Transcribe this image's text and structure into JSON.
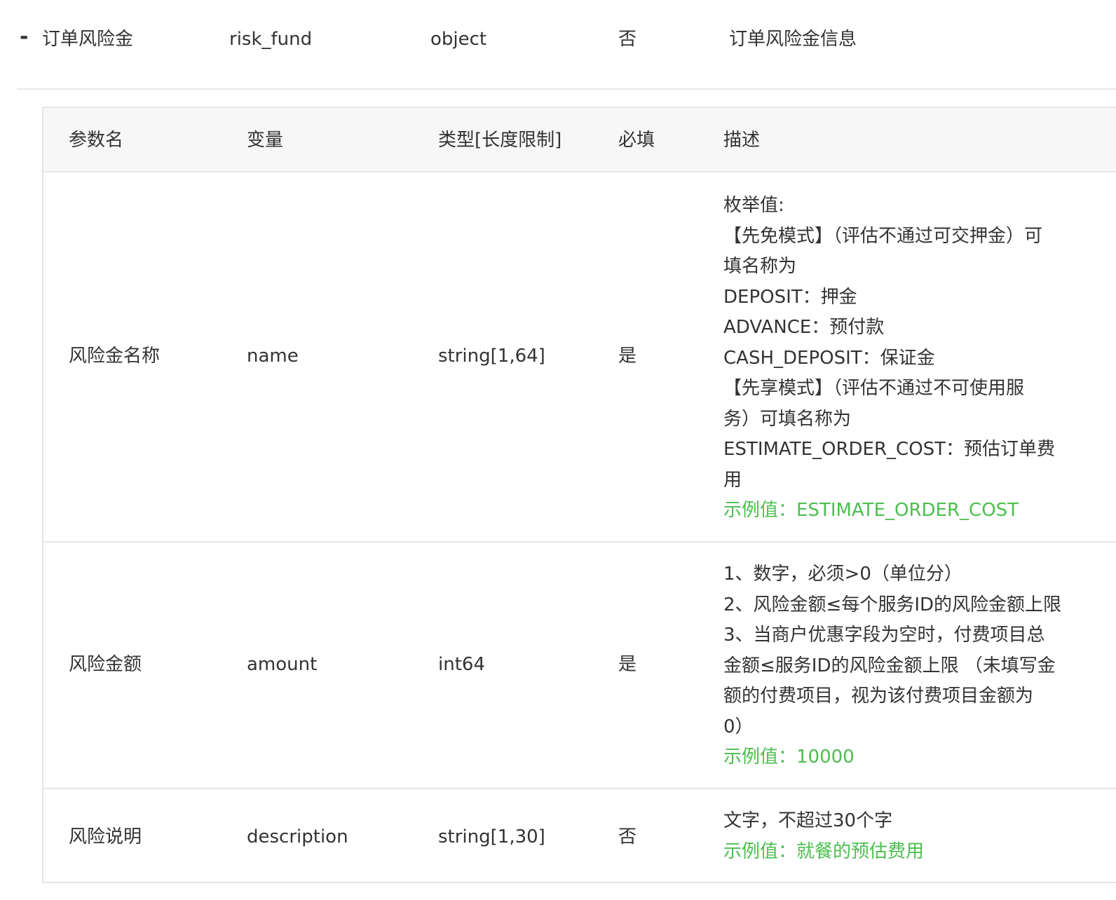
{
  "parent": {
    "toggle": "-",
    "name": "订单风险金",
    "variable": "risk_fund",
    "type": "object",
    "required": "否",
    "description": "订单风险金信息"
  },
  "headers": {
    "name": "参数名",
    "variable": "变量",
    "type": "类型[长度限制]",
    "required": "必填",
    "description": "描述"
  },
  "rows": [
    {
      "name": "风险金名称",
      "variable": "name",
      "type": "string[1,64]",
      "required": "是",
      "desc": [
        "枚举值:",
        "【先免模式】（评估不通过可交押金）可",
        "填名称为",
        "DEPOSIT：押金",
        "ADVANCE：预付款",
        "CASH_DEPOSIT：保证金",
        "【先享模式】（评估不通过不可使用服",
        "务）可填名称为",
        "ESTIMATE_ORDER_COST：预估订单费",
        "用"
      ],
      "example": "示例值：ESTIMATE_ORDER_COST"
    },
    {
      "name": "风险金额",
      "variable": "amount",
      "type": "int64",
      "required": "是",
      "desc": [
        "1、数字，必须>0（单位分）",
        "2、风险金额≤每个服务ID的风险金额上限",
        "3、当商户优惠字段为空时，付费项目总",
        "金额≤服务ID的风险金额上限 （未填写金",
        "额的付费项目，视为该付费项目金额为",
        "0）"
      ],
      "example": "示例值：10000"
    },
    {
      "name": "风险说明",
      "variable": "description",
      "type": "string[1,30]",
      "required": "否",
      "desc": [
        "文字，不超过30个字"
      ],
      "example": "示例值：就餐的预估费用"
    }
  ],
  "colors": {
    "example_green": "#4cbf4f",
    "header_bg": "#f7f7f7",
    "border": "#e6e6e6"
  }
}
